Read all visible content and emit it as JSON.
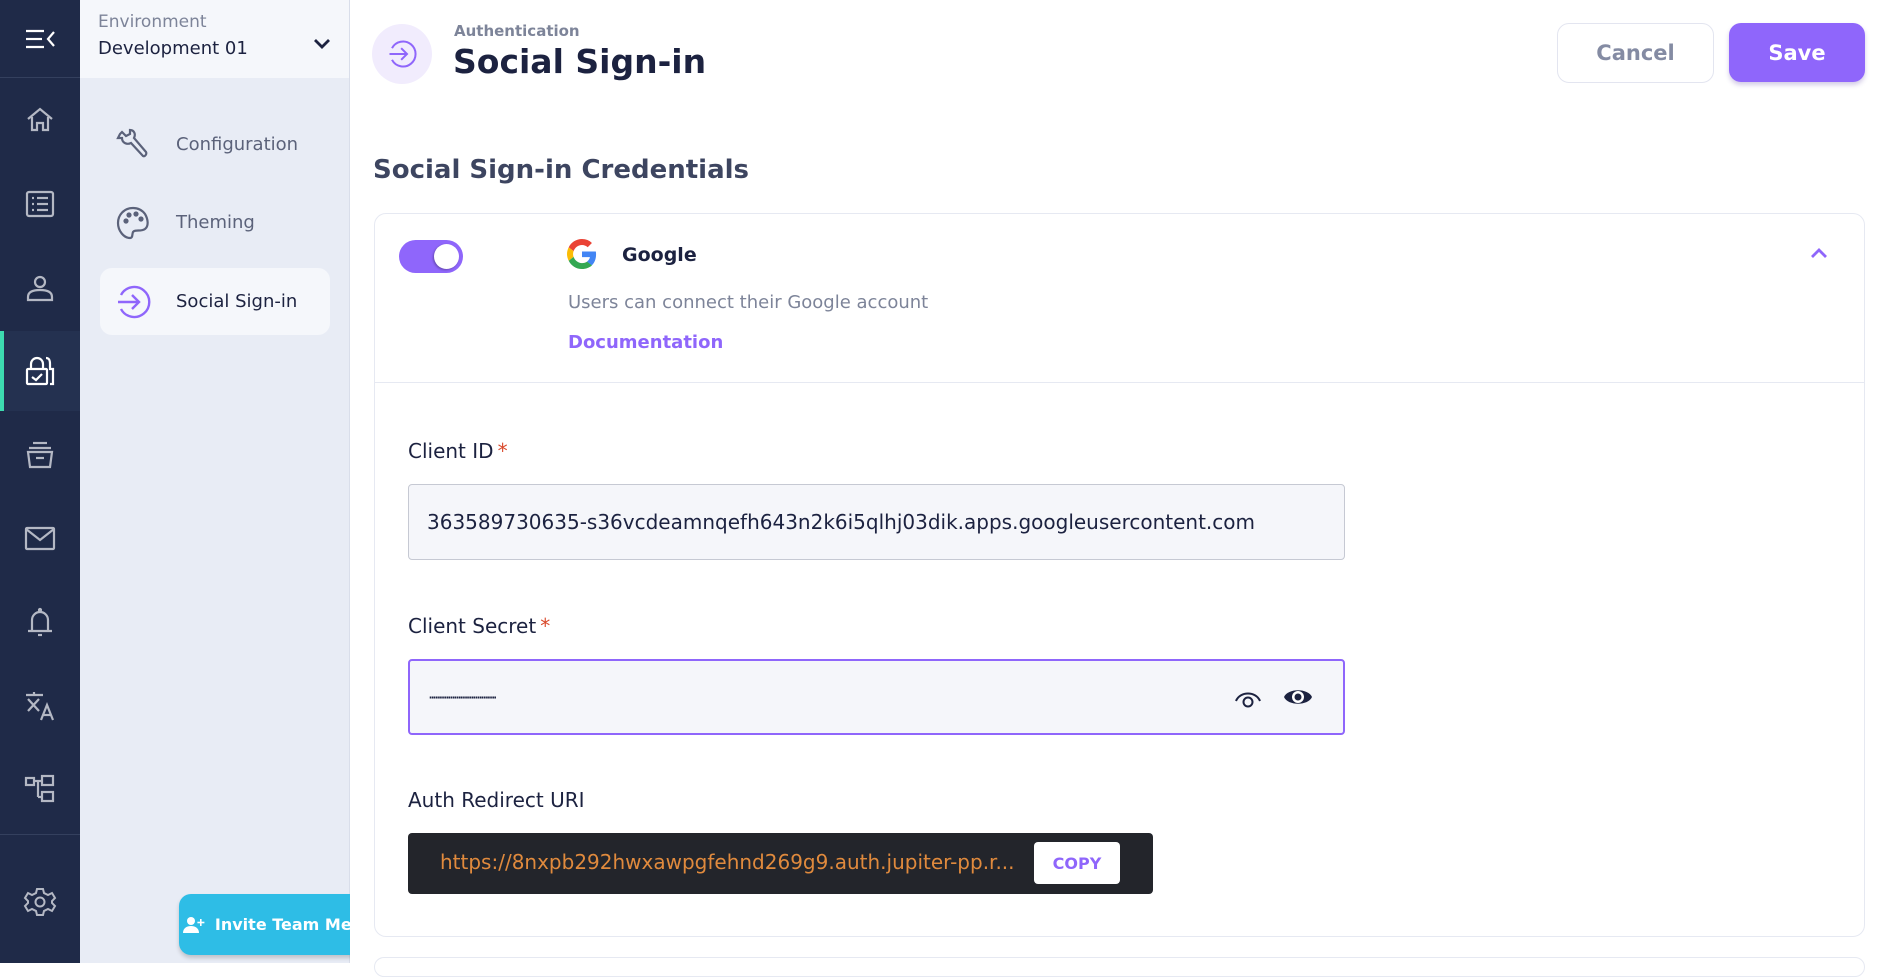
{
  "rail": {
    "items": [
      {
        "name": "home",
        "icon": "home-icon"
      },
      {
        "name": "list",
        "icon": "list-icon"
      },
      {
        "name": "users",
        "icon": "user-icon"
      },
      {
        "name": "authentication",
        "icon": "lock-check-icon",
        "active": true
      },
      {
        "name": "archive",
        "icon": "archive-icon"
      },
      {
        "name": "email",
        "icon": "mail-icon"
      },
      {
        "name": "notifications",
        "icon": "bell-icon"
      },
      {
        "name": "localization",
        "icon": "translate-icon"
      },
      {
        "name": "hierarchy",
        "icon": "hierarchy-icon"
      },
      {
        "name": "settings",
        "icon": "gear-icon"
      }
    ]
  },
  "environment": {
    "label": "Environment",
    "value": "Development 01"
  },
  "subnav": {
    "items": [
      {
        "label": "Configuration",
        "icon": "wrench-icon"
      },
      {
        "label": "Theming",
        "icon": "palette-icon"
      },
      {
        "label": "Social Sign-in",
        "icon": "sign-in-icon",
        "active": true
      }
    ],
    "invite_label": "Invite Team Members"
  },
  "header": {
    "breadcrumb": "Authentication",
    "title": "Social Sign-in",
    "cancel_label": "Cancel",
    "save_label": "Save"
  },
  "section": {
    "title": "Social Sign-in Credentials"
  },
  "provider": {
    "name": "Google",
    "enabled": true,
    "description": "Users can connect their Google account",
    "doc_link": "Documentation",
    "client_id_label": "Client ID",
    "client_id_value": "363589730635-s36vcdeamnqefh643n2k6i5qlhj03dik.apps.googleusercontent.com",
    "client_secret_label": "Client Secret",
    "client_secret_value": "································",
    "required_mark": "*",
    "redirect_label": "Auth Redirect URI",
    "redirect_value": "https://8nxpb292hwxawpgfehnd269g9.auth.jupiter-pp.r...",
    "copy_label": "COPY"
  },
  "colors": {
    "accent": "#8f66fb",
    "rail_bg": "#1f2a48",
    "active_indicator": "#3ddbb0",
    "invite_bg": "#2ebde6",
    "uri_text": "#e08a3d"
  }
}
